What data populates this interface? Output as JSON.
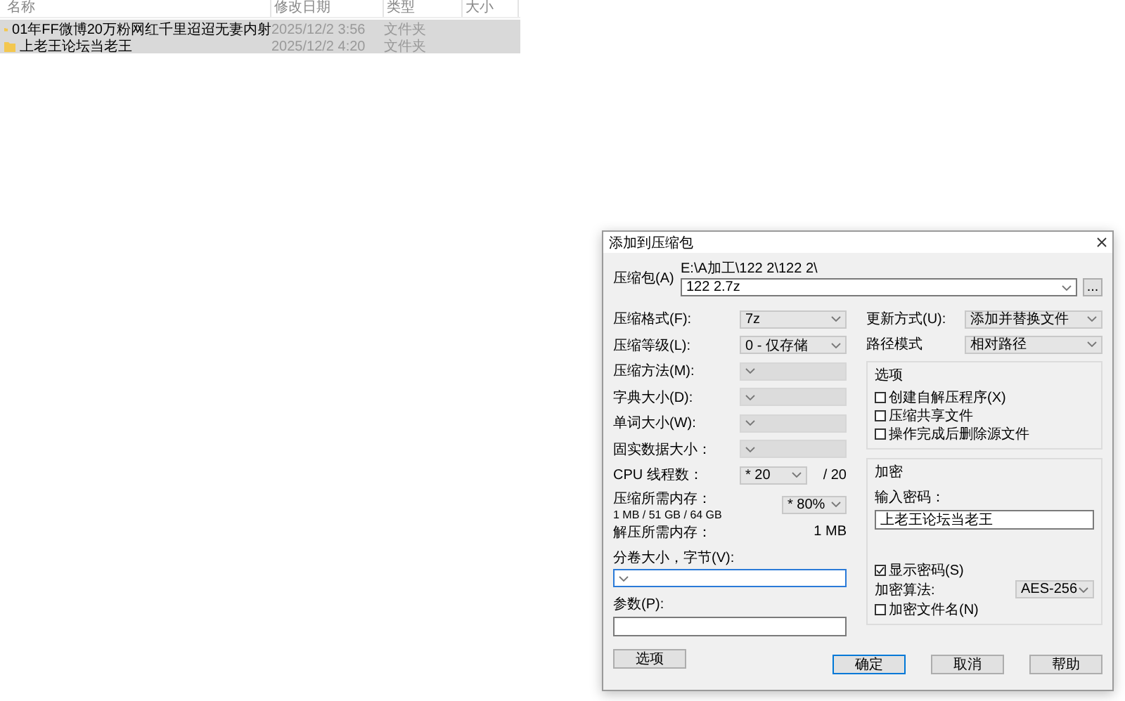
{
  "file_list": {
    "columns": [
      "名称",
      "修改日期",
      "类型",
      "大小"
    ],
    "rows": [
      {
        "name": "01年FF微博20万粉网红千里迢迢无妻内射",
        "date": "2025/12/2 3:56",
        "type": "文件夹",
        "selected": true
      },
      {
        "name": "上老王论坛当老王",
        "date": "2025/12/2 4:20",
        "type": "文件夹",
        "selected": true
      }
    ]
  },
  "dialog": {
    "title": "添加到压缩包",
    "archive": {
      "label": "压缩包(A)",
      "path": "E:\\A加工\\122 2\\122 2\\",
      "value": "122 2.7z",
      "browse": "..."
    },
    "left_rows": [
      {
        "kind": "combo",
        "label": "压缩格式(F):",
        "value": "7z",
        "disabled": false
      },
      {
        "kind": "combo",
        "label": "压缩等级(L):",
        "value": "0 - 仅存储",
        "disabled": false
      },
      {
        "kind": "combo",
        "label": "压缩方法(M):",
        "disabled": true
      },
      {
        "kind": "combo",
        "label": "字典大小(D):",
        "disabled": true
      },
      {
        "kind": "combo",
        "label": "单词大小(W):",
        "disabled": true
      },
      {
        "kind": "combo",
        "label": "固实数据大小：",
        "disabled": true
      },
      {
        "kind": "threads",
        "label": "CPU 线程数：",
        "value": "* 20",
        "total": "/ 20"
      },
      {
        "kind": "memory",
        "label": "压缩所需内存：",
        "detail": "1 MB / 51 GB / 64 GB",
        "value": "* 80%"
      },
      {
        "kind": "info",
        "label": "解压所需内存：",
        "value": "1 MB"
      }
    ],
    "volume": {
      "label": "分卷大小，字节(V):"
    },
    "params": {
      "label": "参数(P):"
    },
    "options_button": "选项",
    "right_rows": [
      {
        "label": "更新方式(U):",
        "value": "添加并替换文件"
      },
      {
        "label": "路径模式",
        "value": "相对路径"
      }
    ],
    "options_group": {
      "title": "选项",
      "checkboxes": [
        {
          "label": "创建自解压程序(X)",
          "checked": false
        },
        {
          "label": "压缩共享文件",
          "checked": false
        },
        {
          "label": "操作完成后删除源文件",
          "checked": false
        }
      ]
    },
    "encryption": {
      "title": "加密",
      "password_label": "输入密码：",
      "password": "上老王论坛当老王",
      "show_password": {
        "label": "显示密码(S)",
        "checked": true
      },
      "method_label": "加密算法:",
      "method": "AES-256",
      "encrypt_names": {
        "label": "加密文件名(N)",
        "checked": false
      }
    },
    "buttons": [
      {
        "label": "确定",
        "default": true
      },
      {
        "label": "取消",
        "default": false
      },
      {
        "label": "帮助",
        "default": false
      }
    ]
  }
}
